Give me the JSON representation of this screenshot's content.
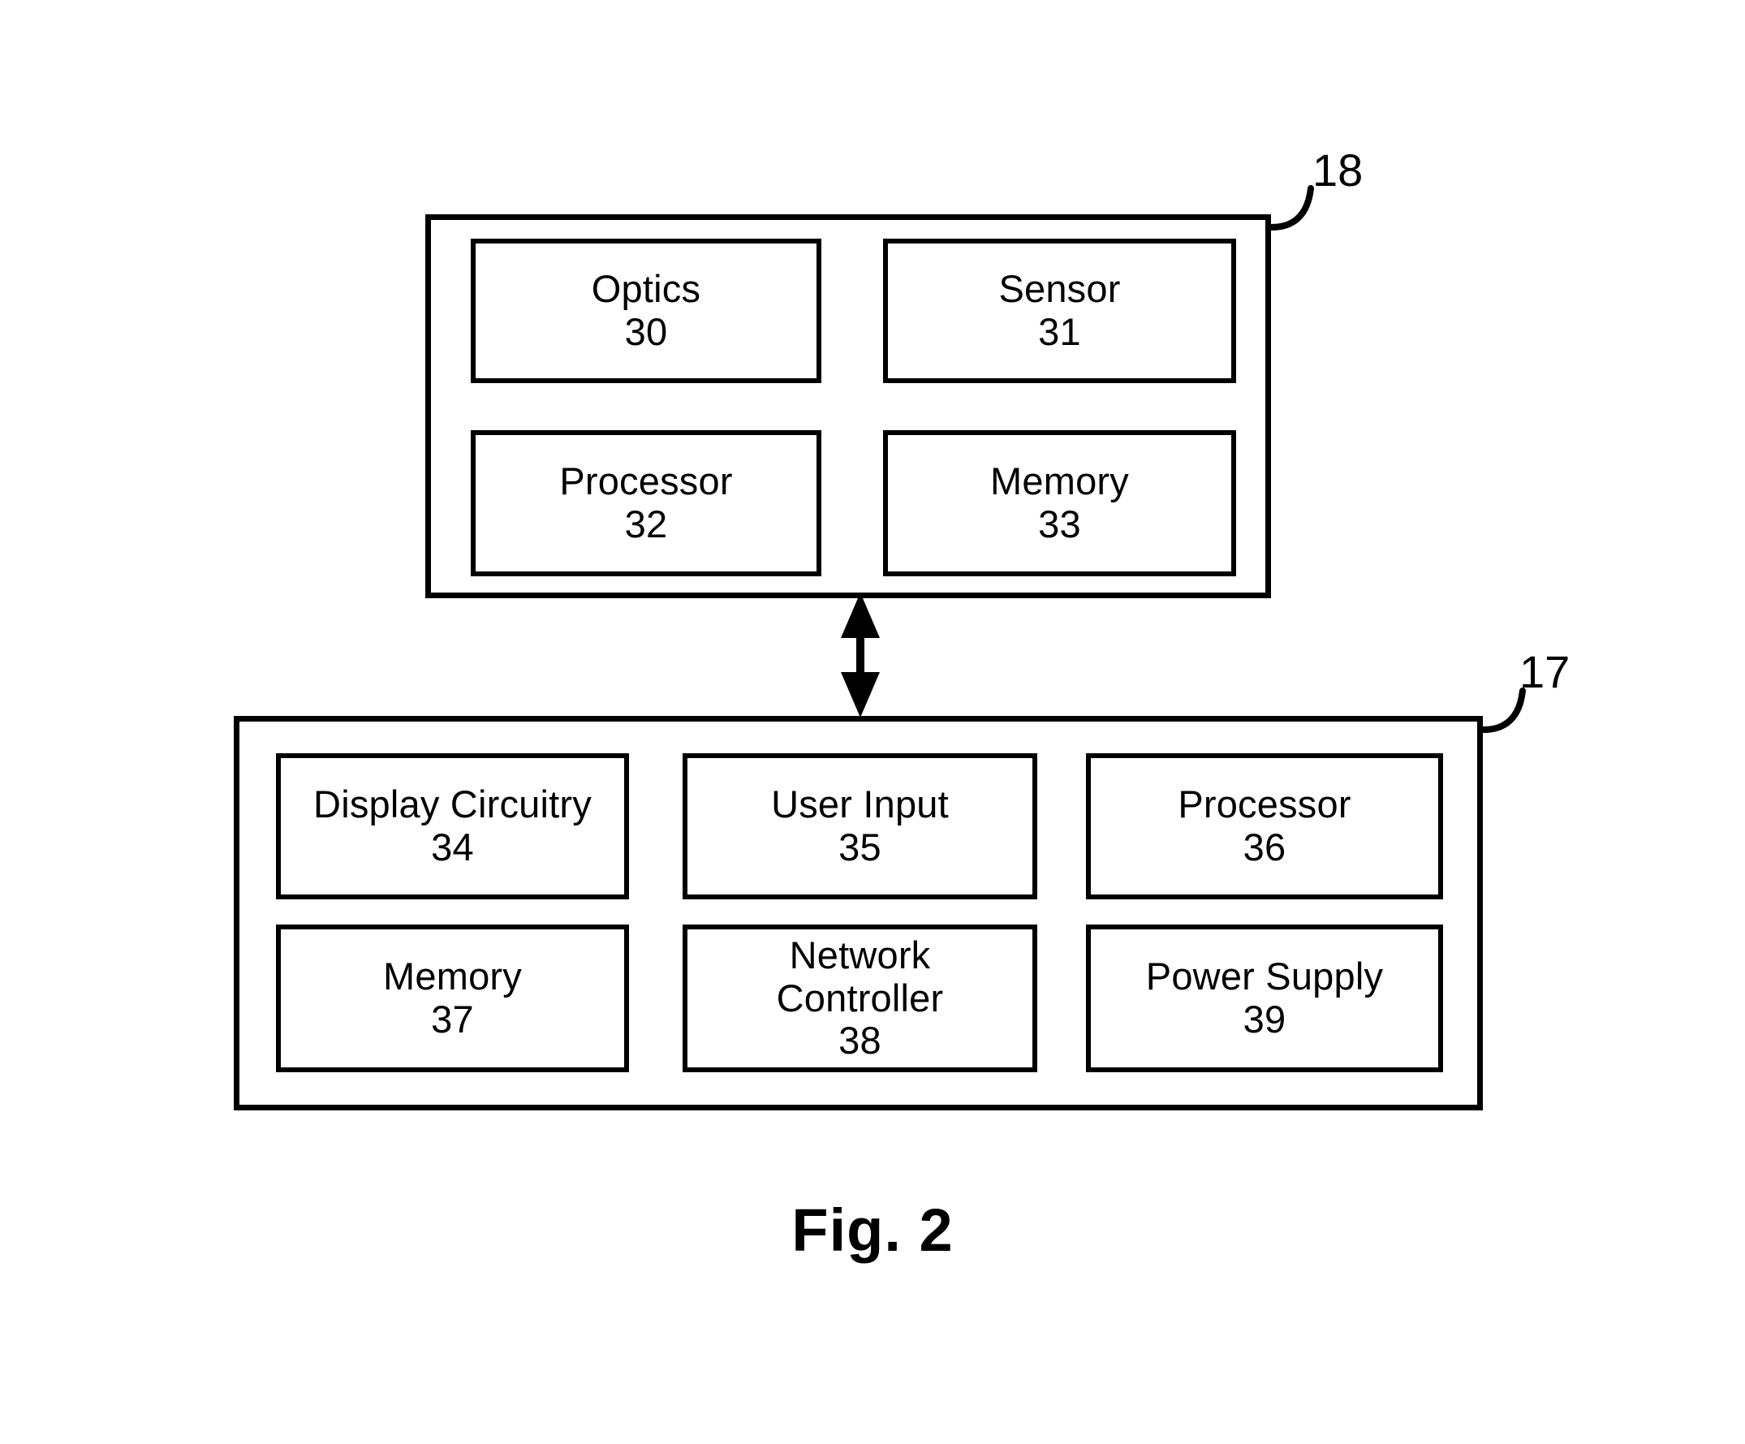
{
  "figure": {
    "caption": "Fig. 2",
    "type": "patent-block-diagram"
  },
  "panels": [
    {
      "id": "camera-module",
      "reference_numeral": "18",
      "components": [
        {
          "label": "Optics",
          "number": "30"
        },
        {
          "label": "Sensor",
          "number": "31"
        },
        {
          "label": "Processor",
          "number": "32"
        },
        {
          "label": "Memory",
          "number": "33"
        }
      ]
    },
    {
      "id": "host-device",
      "reference_numeral": "17",
      "components": [
        {
          "label": "Display Circuitry",
          "number": "34"
        },
        {
          "label": "User Input",
          "number": "35"
        },
        {
          "label": "Processor",
          "number": "36"
        },
        {
          "label": "Memory",
          "number": "37"
        },
        {
          "label": "Network\nController",
          "number": "38"
        },
        {
          "label": "Power Supply",
          "number": "39"
        }
      ]
    }
  ],
  "connector": {
    "name": "bidirectional-link",
    "arrowheads": "both"
  },
  "colors": {
    "stroke": "#000000",
    "background": "#ffffff"
  }
}
